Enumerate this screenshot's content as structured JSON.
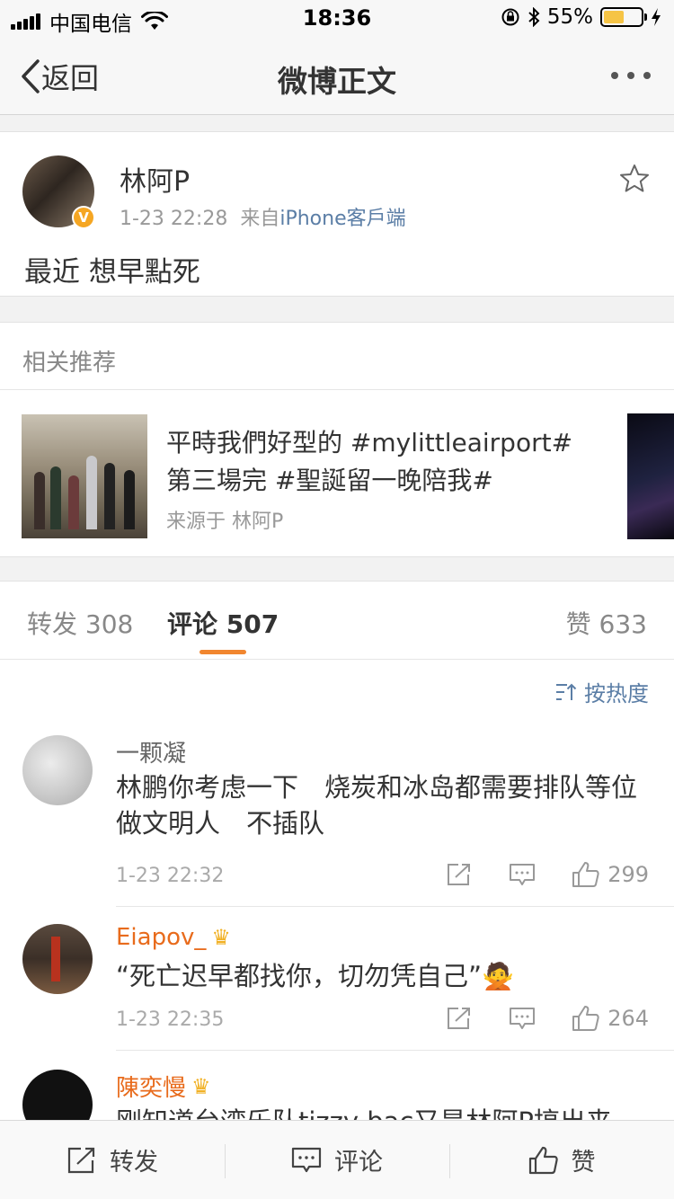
{
  "status_bar": {
    "carrier": "中国电信",
    "time": "18:36",
    "battery_percent": "55%",
    "battery_level": 0.55
  },
  "nav": {
    "back_label": "返回",
    "title": "微博正文"
  },
  "post": {
    "username": "林阿P",
    "timestamp": "1-23 22:28",
    "source_prefix": "来自",
    "source": "iPhone客戶端",
    "text": "最近 想早點死",
    "verified_badge": "V"
  },
  "related": {
    "header": "相关推荐",
    "title": "平時我們好型的 #mylittleairport# 第三場完 #聖誕留一晚陪我#",
    "source": "来源于 林阿P"
  },
  "tabs": {
    "repost": "转发 308",
    "comment": "评论 507",
    "like": "赞 633"
  },
  "sort_label": "按热度",
  "comments": [
    {
      "username": "一颗凝",
      "text": "林鹏你考虑一下　烧炭和冰岛都需要排队等位　做文明人　不插队",
      "time": "1-23 22:32",
      "likes": "299"
    },
    {
      "username": "Eiapov_",
      "text": "“死亡迟早都找你，切勿凭自己”🙅",
      "time": "1-23 22:35",
      "likes": "264"
    },
    {
      "username": "陳奕慢",
      "text": "刚知道台湾乐队tizzy bac又是林阿P搞出来的，太棒"
    }
  ],
  "bottom_bar": {
    "repost": "转发",
    "comment": "评论",
    "like": "赞"
  },
  "colors": {
    "accent_orange": "#f1862f",
    "link_blue": "#5b7ea6",
    "vip_orange": "#e86b1c"
  }
}
